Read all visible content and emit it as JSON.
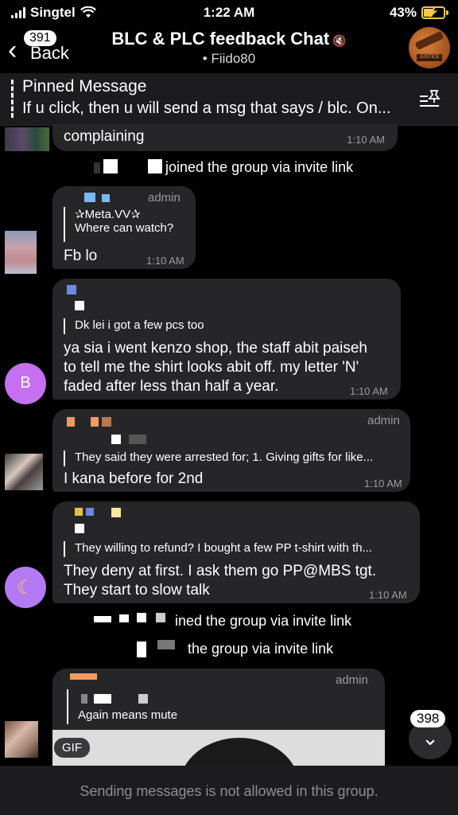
{
  "status_bar": {
    "carrier": "Singtel",
    "time": "1:22 AM",
    "battery": "43%",
    "battery_level": 0.43
  },
  "header": {
    "back_label": "Back",
    "back_badge": "391",
    "title": "BLC & PLC feedback Chat",
    "subtitle": "• Fiido80",
    "avatar_text": "JUSTICE"
  },
  "pinned": {
    "title": "Pinned Message",
    "text": "If u click, then u will send a msg that says / blc. On..."
  },
  "messages": [
    {
      "text": "complaining",
      "time": "1:10 AM"
    },
    {
      "service": "joined the group via invite link"
    },
    {
      "admin": "admin",
      "reply_name": "✰Meta.VV✰",
      "reply_text": "Where can watch?",
      "text": "Fb lo",
      "time": "1:10 AM"
    },
    {
      "avatar_letter": "B",
      "avatar_color": "#c470f0",
      "reply_text": "Dk lei i got a few pcs too",
      "text_lines": [
        "ya sia i went kenzo shop, the staff abit paiseh",
        "to tell me the shirt looks abit off. my letter 'N'",
        "faded after less than half a year."
      ],
      "time": "1:10 AM"
    },
    {
      "admin": "admin",
      "reply_text": "They said they were arrested for; 1. Giving gifts for like...",
      "text": "I kana before for 2nd",
      "time": "1:10 AM"
    },
    {
      "avatar_emoji": "🌙",
      "avatar_color": "#b47af5",
      "reply_text": "They willing to refund? I bought a few PP t-shirt with th...",
      "text_lines": [
        "They deny at first. I ask them go PP@MBS tgt.",
        "They start to slow talk"
      ],
      "time": "1:10 AM"
    },
    {
      "service": "ined the group via invite link"
    },
    {
      "service": "the group via invite link"
    },
    {
      "admin": "admin",
      "reply_text": "Again means mute",
      "gif_label": "GIF"
    }
  ],
  "scroll": {
    "badge": "398"
  },
  "composer": {
    "note": "Sending messages is not allowed in this group."
  }
}
